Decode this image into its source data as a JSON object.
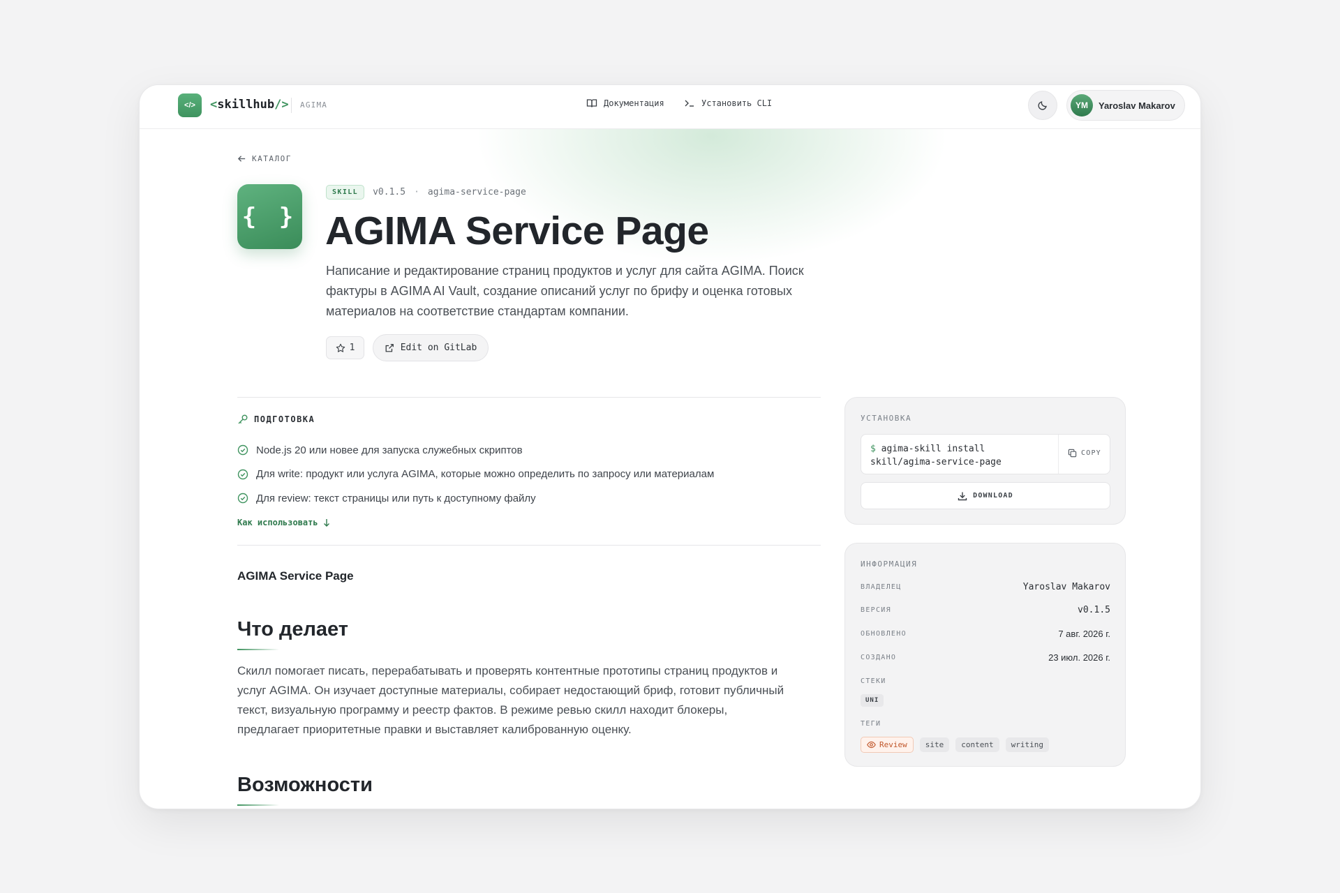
{
  "header": {
    "logo_icon_text": "</>",
    "logo_open": "<",
    "logo_name": "skillhub",
    "logo_close": "/>",
    "org": "AGIMA",
    "nav": [
      {
        "label": "Документация",
        "icon": "book-icon"
      },
      {
        "label": "Установить CLI",
        "icon": "terminal-icon"
      }
    ],
    "theme_icon": "moon-icon",
    "user": {
      "initials": "YM",
      "name": "Yaroslav Makarov"
    }
  },
  "hero": {
    "back_label": "КАТАЛОГ",
    "icon_text": "{ }",
    "badge": "SKILL",
    "version": "v0.1.5",
    "separator": "·",
    "slug": "agima-service-page",
    "title": "AGIMA Service Page",
    "description": "Написание и редактирование страниц продуктов и услуг для сайта AGIMA. Поиск фактуры в AGIMA AI Vault, создание описаний услуг по брифу и оценка готовых материалов на соответствие стандартам компании.",
    "stars": "1",
    "gitlab_label": "Edit on GitLab"
  },
  "preparation": {
    "heading": "ПОДГОТОВКА",
    "items": [
      "Node.js 20 или новее для запуска служебных скриптов",
      "Для write: продукт или услуга AGIMA, которые можно определить по запросу или материалам",
      "Для review: текст страницы или путь к доступному файлу"
    ],
    "how_to_label": "Как использовать"
  },
  "content": {
    "doc_title": "AGIMA Service Page",
    "section1_title": "Что делает",
    "section1_body": "Скилл помогает писать, перерабатывать и проверять контентные прототипы страниц продуктов и услуг AGIMA. Он изучает доступные материалы, собирает недостающий бриф, готовит публичный текст, визуальную программу и реестр фактов. В режиме ревью скилл находит блокеры, предлагает приоритетные правки и выставляет калиброванную оценку.",
    "section2_title": "Возможности"
  },
  "install": {
    "label": "УСТАНОВКА",
    "prompt": "$",
    "command_line1": "agima-skill install",
    "command_line2": "skill/agima-service-page",
    "copy_label": "COPY",
    "download_label": "DOWNLOAD"
  },
  "info": {
    "label": "ИНФОРМАЦИЯ",
    "rows": [
      {
        "key": "ВЛАДЕЛЕЦ",
        "value": "Yaroslav Makarov"
      },
      {
        "key": "ВЕРСИЯ",
        "value": "v0.1.5"
      },
      {
        "key": "ОБНОВЛЕНО",
        "value": "7 авг. 2026 г."
      },
      {
        "key": "СОЗДАНО",
        "value": "23 июл. 2026 г."
      }
    ],
    "stacks_label": "СТЕКИ",
    "stacks": [
      "UNI"
    ],
    "tags_label": "ТЕГИ",
    "tags": [
      "Review",
      "site",
      "content",
      "writing"
    ]
  },
  "colors": {
    "accent": "#3f935f",
    "review": "#c0562a"
  }
}
